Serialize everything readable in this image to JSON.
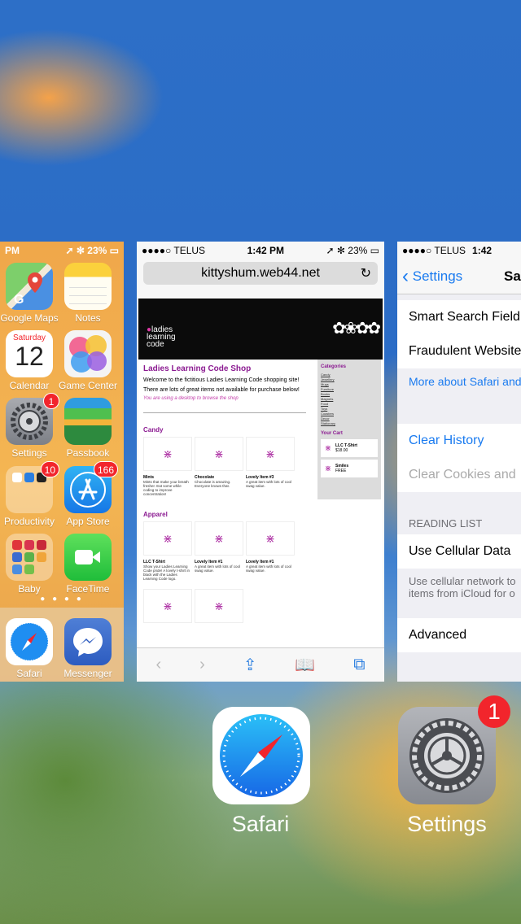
{
  "home_card": {
    "status": {
      "time": "PM",
      "battery": "23%"
    },
    "apps": [
      {
        "label": "Google Maps"
      },
      {
        "label": "Notes"
      },
      {
        "label": "Calendar",
        "day": "Saturday",
        "date": "12"
      },
      {
        "label": "Game Center"
      },
      {
        "label": "Settings",
        "badge": "1"
      },
      {
        "label": "Passbook"
      },
      {
        "label": "Productivity",
        "badge": "10"
      },
      {
        "label": "App Store",
        "badge": "166"
      },
      {
        "label": "Baby"
      },
      {
        "label": "FaceTime"
      }
    ],
    "dock": [
      {
        "label": "Safari"
      },
      {
        "label": "Messenger"
      }
    ]
  },
  "safari_card": {
    "status": {
      "carrier": "●●●●○ TELUS",
      "time": "1:42 PM",
      "battery": "23%"
    },
    "url": "kittyshum.web44.net",
    "page": {
      "logo": [
        "ladies",
        "learning",
        "code"
      ],
      "title": "Ladies Learning Code Shop",
      "intro1": "Welcome to the fictitious Ladies Learning Code shopping site!",
      "intro2": "There are lots of great items not available for purchase below!",
      "notice": "You are using a desktop to browse the shop",
      "sections": {
        "candy": "Candy",
        "apparel": "Apparel"
      },
      "candy_items": [
        {
          "name": "Mints",
          "desc": "Mints that make your breath fresher. Eat some while coding to improve concentration!"
        },
        {
          "name": "Chocolate",
          "desc": "Chocolate is amazing. Everyone knows that."
        },
        {
          "name": "Lovely Item #3",
          "desc": "A great item with lots of cool swag value."
        }
      ],
      "apparel_items": [
        {
          "name": "LLC T-Shirt",
          "desc": "Show your Ladies Learning Code pride! A lovely t-shirt in black with the Ladies Learning Code logo."
        },
        {
          "name": "Lovely Item #1",
          "desc": "A great item with lots of cool swag value."
        },
        {
          "name": "Lovely Item #1",
          "desc": "A great item with lots of cool swag value."
        }
      ],
      "sidebar": {
        "categories_title": "Categories",
        "categories": [
          "Candy",
          "Jewellery",
          "Mugs",
          "Furniture",
          "Books",
          "Magnets",
          "Food",
          "Toys",
          "Coasters",
          "Decor",
          "Stationary"
        ],
        "cart_title": "Your Cart",
        "cart": [
          {
            "name": "LLC T-Shirt",
            "price": "$18.00"
          },
          {
            "name": "Smiles",
            "price": "FREE"
          }
        ]
      }
    }
  },
  "settings_card": {
    "status": {
      "carrier": "●●●●○ TELUS",
      "time": "1:42"
    },
    "back_label": "Settings",
    "title": "Saf",
    "rows": {
      "smart_search": "Smart Search Field",
      "fraudulent": "Fraudulent Website",
      "more_about": "More about Safari and",
      "clear_history": "Clear History",
      "clear_cookies": "Clear Cookies and",
      "reading_list_header": "READING LIST",
      "use_cellular": "Use Cellular Data",
      "cellular_desc1": "Use cellular network to",
      "cellular_desc2": "items from iCloud for o",
      "advanced": "Advanced"
    }
  },
  "switcher": {
    "safari_label": "Safari",
    "settings_label": "Settings",
    "settings_badge": "1"
  },
  "colors": {
    "ios_blue": "#1a7bf0",
    "badge_red": "#f2252c",
    "llc_purple": "#8b1a91"
  }
}
